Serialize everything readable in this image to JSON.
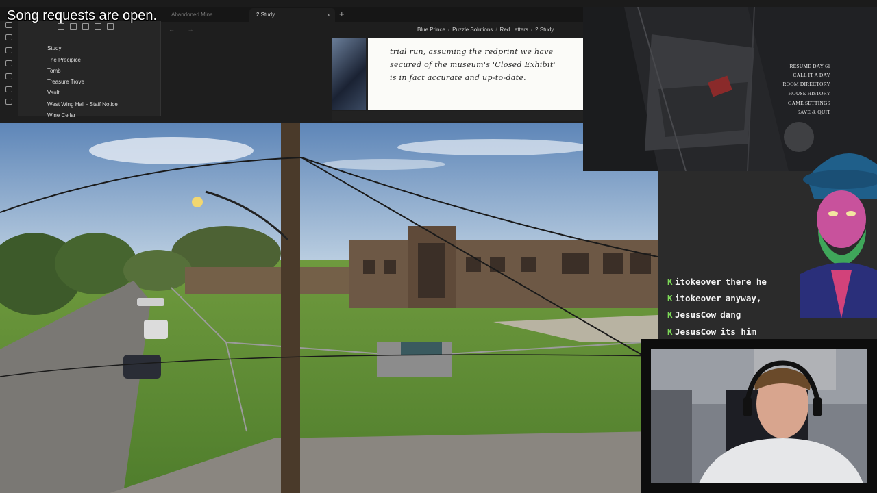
{
  "overlay": {
    "song_requests": "Song requests are open."
  },
  "app": {
    "tabs": [
      {
        "label": "Abandoned Mine",
        "active": false
      },
      {
        "label": "2 Study",
        "active": true
      }
    ],
    "tab_close_glyph": "×",
    "tab_add_glyph": "+",
    "nav_arrows": "← →",
    "breadcrumb": [
      "Blue Prince",
      "Puzzle Solutions",
      "Red Letters",
      "2 Study"
    ],
    "breadcrumb_sep": "/",
    "files": [
      "Study",
      "The Precipice",
      "Tomb",
      "Treasure Trove",
      "Vault",
      "West Wing Hall - Staff Notice",
      "Wine Cellar"
    ],
    "ribbon_icons": [
      "sidebar-toggle-icon",
      "files-icon",
      "search-icon",
      "graph-icon",
      "canvas-icon",
      "calendar-icon",
      "copy-icon",
      "terminal-icon"
    ],
    "toolbar_icons": [
      "new-note-icon",
      "new-folder-icon",
      "sort-icon",
      "collapse-icon",
      "close-icon"
    ],
    "note_lines": [
      "trial run, assuming the redprint we have",
      "secured of the museum's 'Closed Exhibit'",
      "is in fact accurate and up-to-date."
    ]
  },
  "game_menu": {
    "items": [
      {
        "label": "RESUME",
        "extra": "DAY 61"
      },
      {
        "label": "CALL IT A DAY",
        "extra": ""
      },
      {
        "label": "ROOM DIRECTORY",
        "extra": ""
      },
      {
        "label": "HOUSE HISTORY",
        "extra": ""
      },
      {
        "label": "GAME SETTINGS",
        "extra": ""
      },
      {
        "label": "SAVE & QUIT",
        "extra": ""
      }
    ]
  },
  "chat": {
    "badge_glyph": "K",
    "messages": [
      {
        "user": "itokeover",
        "text": "there he"
      },
      {
        "user": "itokeover",
        "text": "anyway,"
      },
      {
        "user": "JesusCow",
        "text": "dang"
      },
      {
        "user": "JesusCow",
        "text": "its him"
      }
    ]
  },
  "colors": {
    "chat_badge": "#7cd957",
    "app_bg": "#1e1e1e",
    "sidebar_bg": "#262626",
    "game_bg": "#2a2b2e"
  }
}
